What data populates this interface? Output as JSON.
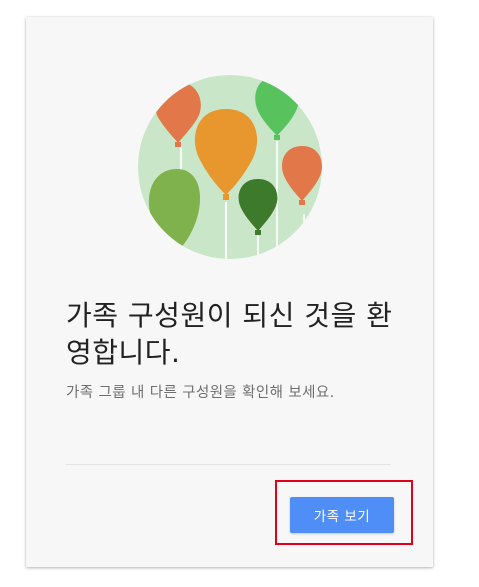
{
  "dialog": {
    "headline": "가족 구성원이 되신 것을 환영합니다.",
    "subtitle": "가족 그룹 내 다른 구성원을 확인해 보세요.",
    "primary_button_label": "가족 보기"
  },
  "illustration": {
    "icon": "family-balloons-icon",
    "background_color": "#c9e6c9",
    "balloon_colors": [
      "#e2774a",
      "#e8962e",
      "#58c35d",
      "#7fb24c",
      "#3d7a2c",
      "#e2774a"
    ]
  },
  "colors": {
    "accent": "#4f8ef7",
    "highlight": "#e0001b",
    "card_background": "#f7f7f7"
  }
}
